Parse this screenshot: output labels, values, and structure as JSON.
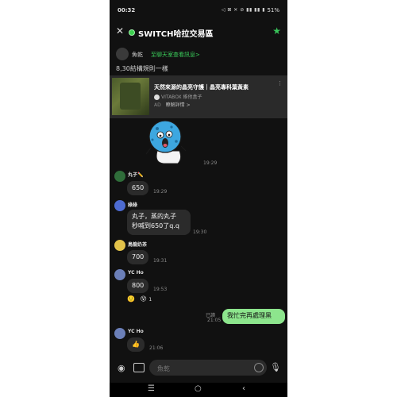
{
  "status_bar": {
    "time": "00:32",
    "icons": "◁ ⊠ ✕ ⊘ ▮▮ ▮▮ ▮",
    "battery": "51%"
  },
  "header": {
    "title": "SWITCH哈拉交易區"
  },
  "notice": {
    "name": "魚乾",
    "link": "至聊天室查看訊息>"
  },
  "pinned_text": "8,30結構規則一樣",
  "ad": {
    "title": "天然來源的晶亮守護｜晶亮專科葉黃素",
    "brand": "VITABOX 維他盒子",
    "label": "AD",
    "cta": "瞭解詳情 >"
  },
  "messages": [
    {
      "sender": "丸子✏️",
      "text": "650",
      "time": "19:29"
    },
    {
      "sender": "綠綠",
      "lines": [
        "丸子，蒸的丸子",
        "秒喊到650了q.q"
      ],
      "time": "19:30"
    },
    {
      "sender": "鳥龍奶茶",
      "text": "700",
      "time": "19:31"
    },
    {
      "sender": "YC Ho",
      "text": "800",
      "time": "19:53"
    },
    {
      "read": "已讀",
      "text": "我忙完再處理黑",
      "time": "21:05"
    },
    {
      "sender": "YC Ho",
      "text": "👍",
      "time": "21:06"
    }
  ],
  "sticker_time": "19:29",
  "reaction_count": "1",
  "input": {
    "placeholder": "魚乾"
  },
  "colors": {
    "accent": "#3ccf4e",
    "bubble_mine": "#8de58d",
    "bubble_other": "#2b2b2b",
    "background": "#111111"
  }
}
